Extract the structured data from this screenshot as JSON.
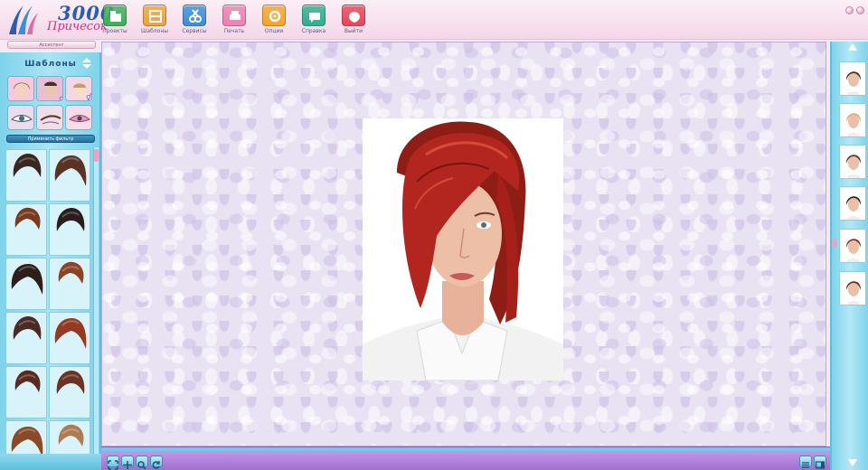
{
  "app": {
    "logo_number": "3000",
    "logo_text": "Причесок"
  },
  "toolbar": {
    "items": [
      {
        "label": "Проекты",
        "icon": "projects-icon",
        "color": "#3dae5c"
      },
      {
        "label": "Шаблоны",
        "icon": "templates-icon",
        "color": "#f0a23a"
      },
      {
        "label": "Сервисы",
        "icon": "services-icon",
        "color": "#3a8fd8"
      },
      {
        "label": "Печать",
        "icon": "print-icon",
        "color": "#ee7fb3"
      },
      {
        "label": "Опции",
        "icon": "options-icon",
        "color": "#f4a52a"
      },
      {
        "label": "Справка",
        "icon": "help-icon",
        "color": "#2fae8e"
      },
      {
        "label": "Выйти",
        "icon": "exit-icon",
        "color": "#e8445a"
      }
    ]
  },
  "assistant": {
    "label": "Ассистент"
  },
  "left_panel": {
    "title": "Шаблоны",
    "filter_button": "Применить фильтр",
    "categories": [
      "female-face",
      "male-face",
      "child-face",
      "eyes",
      "eyebrows",
      "lips"
    ]
  },
  "hair_colors": [
    "#3a2620",
    "#5b3325",
    "#7a3a1e",
    "#2b1d1a",
    "#2e1e1a",
    "#8b4422",
    "#4a2a22",
    "#933a22",
    "#5a2a20",
    "#6a3322",
    "#8a4a2a",
    "#b07a52"
  ],
  "right_panel": {
    "thumb_hair": [
      "#4a3326",
      "#d9b07a",
      "#5a3a2c",
      "#3a2822",
      "#8a3524",
      "#6b3022"
    ]
  },
  "colors": {
    "accent_pink": "#f4d7e8",
    "panel_blue": "#7fd3ea",
    "bottom_purple": "#a06fd0",
    "hair_red": "#b2261f"
  }
}
